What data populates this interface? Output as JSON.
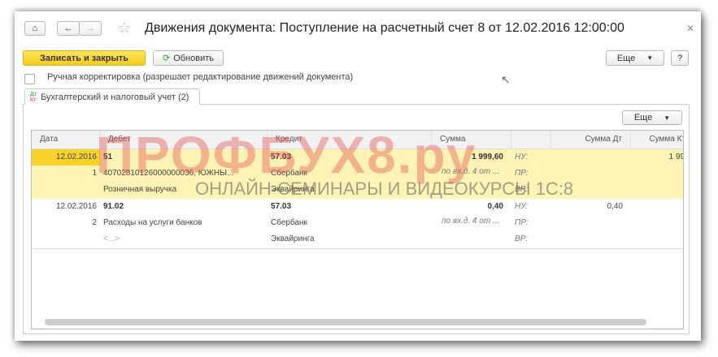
{
  "window": {
    "title": "Движения документа: Поступление на расчетный счет 8 от 12.02.2016 12:00:00"
  },
  "toolbar": {
    "save_close": "Записать и закрыть",
    "refresh": "Обновить",
    "more": "Еще",
    "help": "?"
  },
  "manual_edit": {
    "label": "Ручная корректировка (разрешает редактирование движений документа)",
    "checked": false
  },
  "tabs": [
    {
      "label": "Бухгалтерский и налоговый учет (2)",
      "icon": "dt-kt-icon",
      "active": true
    }
  ],
  "grid": {
    "more": "Еще",
    "columns": [
      "Дата",
      "Дебет",
      "Кредит",
      "Сумма",
      "",
      "Сумма Дт",
      "Сумма Кт"
    ],
    "records": [
      {
        "date": "12.02.2016",
        "num": "1",
        "debit": "51",
        "debit_sub1": "40702810126000000036, ЮЖНЫ...",
        "debit_sub2": "Розничная выручка",
        "credit": "57.03",
        "credit_sub1": "Сбербанк",
        "credit_sub2": "Эквайринга",
        "sum": "1 999,60",
        "content": "по вх.д. 4 от ...",
        "nu": "НУ:",
        "pr": "ПР:",
        "vr": "ВР:",
        "sum_dt": "",
        "sum_kt": "1 99"
      },
      {
        "date": "12.02.2016",
        "num": "2",
        "debit": "91.02",
        "debit_sub1": "Расходы на услуги банков",
        "debit_sub2": "<...>",
        "credit": "57.03",
        "credit_sub1": "Сбербанк",
        "credit_sub2": "Эквайринга",
        "sum": "0,40",
        "content": "по вх.д. 4 от ...",
        "nu": "НУ:",
        "pr": "ПР:",
        "vr": "ВР:",
        "sum_dt": "0,40",
        "sum_kt": ""
      }
    ]
  },
  "watermark": {
    "brand": "ПРОФБУХ8.ру",
    "tagline": "ОНЛАЙН-СЕМИНАРЫ И ВИДЕОКУРСЫ 1С:8"
  },
  "colors": {
    "accent": "#f5cc1d",
    "selection": "#fdf3b4"
  }
}
